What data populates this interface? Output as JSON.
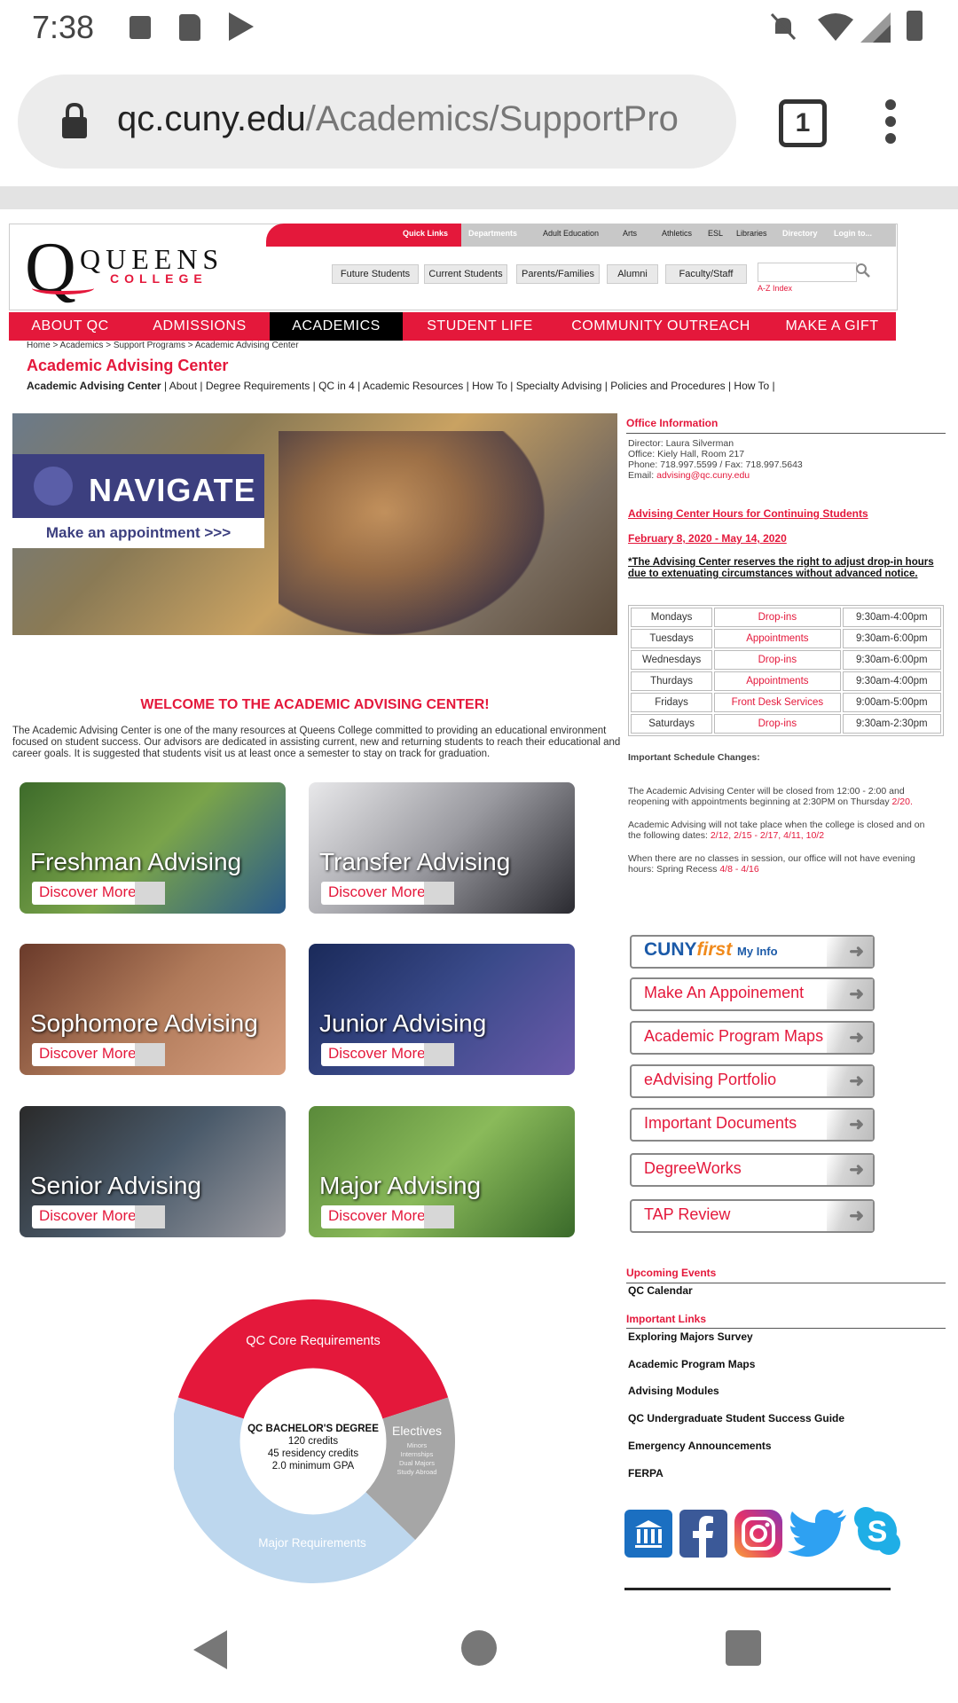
{
  "status_bar": {
    "time": "7:38"
  },
  "browser": {
    "url_host": "qc.cuny.edu",
    "url_path": "/Academics/SupportPro",
    "tab_count": "1"
  },
  "quick_links": [
    "Quick Links",
    "Departments",
    "Adult Education",
    "Arts",
    "Athletics",
    "ESL",
    "Libraries",
    "Directory",
    "Login to..."
  ],
  "logo": {
    "q": "Q",
    "queens": "QUEENS",
    "college": "COLLEGE"
  },
  "audience_links": [
    "Future Students",
    "Current Students",
    "Parents/Families",
    "Alumni",
    "Faculty/Staff"
  ],
  "az_index": "A-Z Index",
  "main_nav": [
    "ABOUT QC",
    "ADMISSIONS",
    "ACADEMICS",
    "STUDENT LIFE",
    "COMMUNITY OUTREACH",
    "MAKE A GIFT"
  ],
  "breadcrumb": "Home > Academics > Support Programs > Academic Advising Center",
  "page_title": "Academic Advising Center",
  "sub_nav": [
    "Academic Advising Center",
    "About",
    "Degree Requirements",
    "QC in 4",
    "Academic Resources",
    "How To",
    "Specialty Advising",
    "Policies and Procedures",
    "How To"
  ],
  "banner": {
    "title": "NAVIGATE",
    "cta": "Make an appointment >>>"
  },
  "welcome": "WELCOME TO THE ACADEMIC ADVISING CENTER!",
  "intro": "The Academic Advising Center is one of the many resources at Queens College committed to providing an educational environment focused on student success. Our advisors are dedicated in assisting current, new and returning students to reach their educational and career goals. It is suggested that students visit us at least once a semester to stay on track for graduation.",
  "tiles": [
    {
      "label": "Freshman Advising",
      "cta": "Discover More"
    },
    {
      "label": "Transfer Advising",
      "cta": "Discover More"
    },
    {
      "label": "Sophomore Advising",
      "cta": "Discover More"
    },
    {
      "label": "Junior Advising",
      "cta": "Discover More"
    },
    {
      "label": "Senior Advising",
      "cta": "Discover More"
    },
    {
      "label": "Major Advising",
      "cta": "Discover More"
    }
  ],
  "donut": {
    "core": "QC Core Requirements",
    "major": "Major Requirements",
    "electives": "Electives",
    "electives_sub": [
      "Minors",
      "Internships",
      "Dual Majors",
      "Study Abroad"
    ],
    "center_title": "QC BACHELOR'S DEGREE",
    "center_lines": [
      "120 credits",
      "45 residency credits",
      "2.0 minimum GPA"
    ],
    "colors": {
      "core": "#e4183b",
      "major": "#bdd7ee",
      "electives": "#a6a6a6"
    }
  },
  "office": {
    "heading": "Office Information",
    "director": "Director: Laura Silverman",
    "office": "Office: Kiely Hall, Room 217",
    "phone": "Phone: 718.997.5599 / Fax: 718.997.5643",
    "email_label": "Email:",
    "email": "advising@qc.cuny.edu"
  },
  "hours": {
    "heading": "Advising Center Hours for Continuing Students",
    "dates": "February 8, 2020 - May 14, 2020",
    "notice": "*The Advising Center reserves the right to adjust drop-in hours due to extenuating circumstances without advanced notice.",
    "rows": [
      {
        "day": "Mondays",
        "type": "Drop-ins",
        "time": "9:30am-4:00pm"
      },
      {
        "day": "Tuesdays",
        "type": "Appointments",
        "time": "9:30am-6:00pm"
      },
      {
        "day": "Wednesdays",
        "type": "Drop-ins",
        "time": "9:30am-6:00pm"
      },
      {
        "day": "Thurdays",
        "type": "Appointments",
        "time": "9:30am-4:00pm"
      },
      {
        "day": "Fridays",
        "type": "Front Desk Services",
        "time": "9:00am-5:00pm"
      },
      {
        "day": "Saturdays",
        "type": "Drop-ins",
        "time": "9:30am-2:30pm"
      }
    ]
  },
  "schedule": {
    "heading": "Important Schedule Changes:",
    "p1": "The Academic Advising Center will be closed from 12:00 - 2:00 and reopening with appointments beginning at 2:30PM on Thursday",
    "p1_red": "2/20.",
    "p2": "Academic Advising will not take place when the college is closed and on the following dates:",
    "p2_red": "2/12, 2/15 - 2/17, 4/11, 10/2",
    "p3": "When there are no classes in session, our office will not have evening hours: Spring Recess",
    "p3_red": "4/8 - 4/16"
  },
  "side_buttons": {
    "cunyfirst": {
      "cuny": "CUNY",
      "first": "first",
      "myinfo": "My Info"
    },
    "items": [
      "Make An Appoinement",
      "Academic Program Maps",
      "eAdvising Portfolio",
      "Important Documents",
      "DegreeWorks",
      "TAP Review"
    ]
  },
  "upcoming": {
    "heading": "Upcoming Events",
    "items": [
      "QC Calendar"
    ]
  },
  "important_links": {
    "heading": "Important Links",
    "items": [
      "Exploring Majors Survey",
      "Academic Program Maps",
      "Advising Modules",
      "QC Undergraduate Student Success Guide",
      "Emergency Announcements",
      "FERPA"
    ]
  },
  "social_icons": [
    "navigate-icon",
    "facebook-icon",
    "instagram-icon",
    "twitter-icon",
    "skype-icon"
  ]
}
